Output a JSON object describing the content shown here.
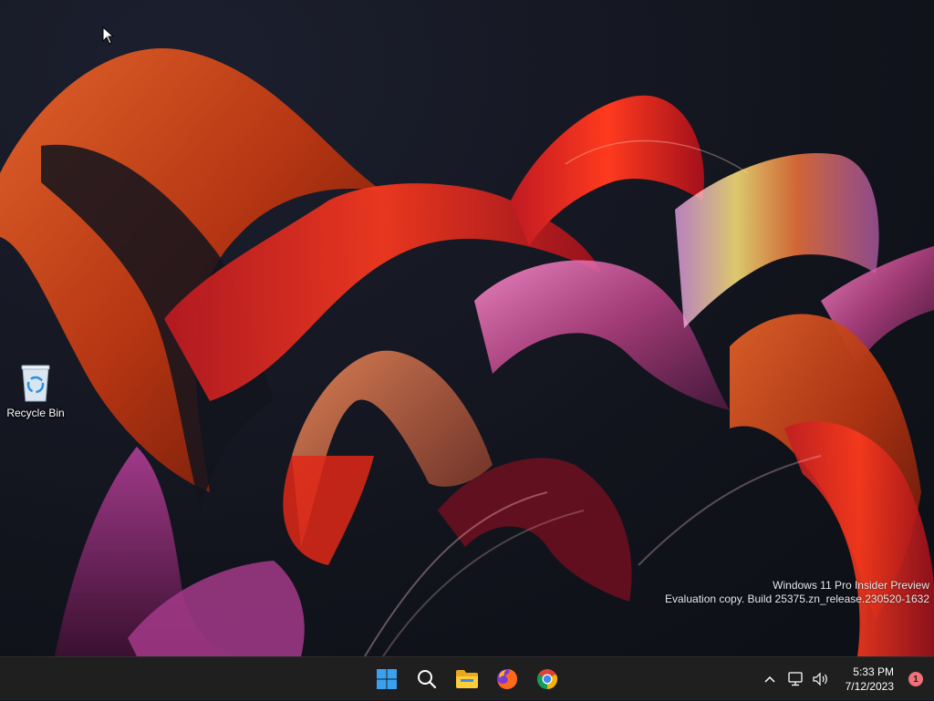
{
  "desktop": {
    "icons": [
      {
        "label": "Recycle Bin",
        "icon": "recycle-bin-icon"
      }
    ],
    "watermark": {
      "line1": "Windows 11 Pro Insider Preview",
      "line2": "Evaluation copy. Build 25375.zn_release.230520-1632"
    }
  },
  "taskbar": {
    "pinned": [
      {
        "name": "start",
        "icon": "windows-logo-icon"
      },
      {
        "name": "search",
        "icon": "search-icon"
      },
      {
        "name": "file-explorer",
        "icon": "folder-icon"
      },
      {
        "name": "firefox",
        "icon": "firefox-icon"
      },
      {
        "name": "chrome",
        "icon": "chrome-icon"
      }
    ],
    "tray": {
      "time": "5:33 PM",
      "date": "7/12/2023",
      "notification_count": "1"
    }
  },
  "colors": {
    "taskbar_bg": "#1f1f1f",
    "start_blue": "#3aa0f0",
    "notification_badge": "#f1707a"
  }
}
